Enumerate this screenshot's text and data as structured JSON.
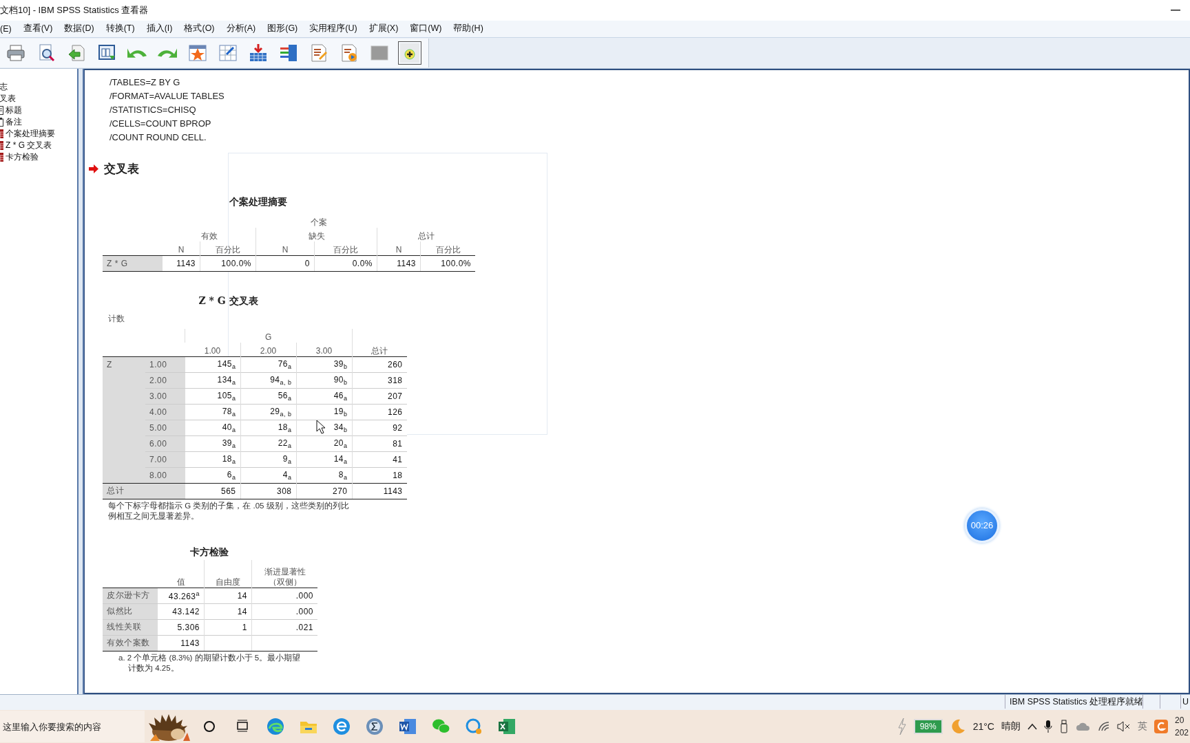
{
  "window": {
    "title": "文档10] - IBM SPSS Statistics 查看器"
  },
  "menu": [
    "(E)",
    "查看(V)",
    "数据(D)",
    "转换(T)",
    "插入(I)",
    "格式(O)",
    "分析(A)",
    "图形(G)",
    "实用程序(U)",
    "扩展(X)",
    "窗口(W)",
    "帮助(H)"
  ],
  "outline": [
    {
      "label": "志"
    },
    {
      "label": "叉表",
      "children": [
        {
          "label": "标题",
          "kind": "title"
        },
        {
          "label": "备注",
          "kind": "notes"
        },
        {
          "label": "个案处理摘要",
          "kind": "table"
        },
        {
          "label": "Z * G 交叉表",
          "kind": "table"
        },
        {
          "label": "卡方检验",
          "kind": "table"
        }
      ]
    }
  ],
  "syntax": [
    "/TABLES=Z BY G",
    "/FORMAT=AVALUE TABLES",
    "/STATISTICS=CHISQ",
    "/CELLS=COUNT BPROP",
    "/COUNT ROUND CELL."
  ],
  "heading": "交叉表",
  "case_summary": {
    "title": "个案处理摘要",
    "group": "个案",
    "groups": [
      "有效",
      "缺失",
      "总计"
    ],
    "subheaders": [
      "N",
      "百分比",
      "N",
      "百分比",
      "N",
      "百分比"
    ],
    "rows": [
      {
        "label": "Z * G",
        "cells": [
          "1143",
          "100.0%",
          "0",
          "0.0%",
          "1143",
          "100.0%"
        ]
      }
    ]
  },
  "crosstab": {
    "title": "Z * G 交叉表",
    "subtitle": "计数",
    "column_variable": "G",
    "columns": [
      "1.00",
      "2.00",
      "3.00",
      "总计"
    ],
    "row_variable": "Z",
    "rows": [
      {
        "label": "1.00",
        "cells": [
          "145$_{a}$",
          "76$_{a}$",
          "39$_{b}$",
          "260"
        ]
      },
      {
        "label": "2.00",
        "cells": [
          "134$_{a}$",
          "94$_{a, b}$",
          "90$_{b}$",
          "318"
        ]
      },
      {
        "label": "3.00",
        "cells": [
          "105$_{a}$",
          "56$_{a}$",
          "46$_{a}$",
          "207"
        ]
      },
      {
        "label": "4.00",
        "cells": [
          "78$_{a}$",
          "29$_{a, b}$",
          "19$_{b}$",
          "126"
        ]
      },
      {
        "label": "5.00",
        "cells": [
          "40$_{a}$",
          "18$_{a}$",
          "34$_{b}$",
          "92"
        ]
      },
      {
        "label": "6.00",
        "cells": [
          "39$_{a}$",
          "22$_{a}$",
          "20$_{a}$",
          "81"
        ]
      },
      {
        "label": "7.00",
        "cells": [
          "18$_{a}$",
          "9$_{a}$",
          "14$_{a}$",
          "41"
        ]
      },
      {
        "label": "8.00",
        "cells": [
          "6$_{a}$",
          "4$_{a}$",
          "8$_{a}$",
          "18"
        ]
      }
    ],
    "total": {
      "label": "总计",
      "cells": [
        "565",
        "308",
        "270",
        "1143"
      ]
    },
    "footnote": "每个下标字母都指示 G 类别的子集，在 .05 级别，这些类别的列比例相互之间无显著差异。"
  },
  "chi_square": {
    "title": "卡方检验",
    "columns": [
      {
        "lines": [
          "值"
        ]
      },
      {
        "lines": [
          "自由度"
        ]
      },
      {
        "lines": [
          "渐进显著性",
          "（双侧）"
        ]
      }
    ],
    "rows": [
      {
        "label": "皮尔逊卡方",
        "cells": [
          "43.263$^{a}$",
          "14",
          ".000"
        ]
      },
      {
        "label": "似然比",
        "cells": [
          "43.142",
          "14",
          ".000"
        ]
      },
      {
        "label": "线性关联",
        "cells": [
          "5.306",
          "1",
          ".021"
        ]
      },
      {
        "label": "有效个案数",
        "cells": [
          "1143"
        ]
      }
    ],
    "footnote": "a. 2 个单元格 (8.3%) 的期望计数小于 5。最小期望计数为 4.25。"
  },
  "status_bar": {
    "message": "IBM SPSS Statistics 处理程序就绪",
    "cell_4": "U"
  },
  "timer": "00:26",
  "taskbar": {
    "search_placeholder": "这里输入你要搜索的内容",
    "battery": "98%",
    "temperature": "21°C",
    "weather": "晴朗",
    "ime": "英",
    "clock_time": "20",
    "clock_date": "202"
  }
}
